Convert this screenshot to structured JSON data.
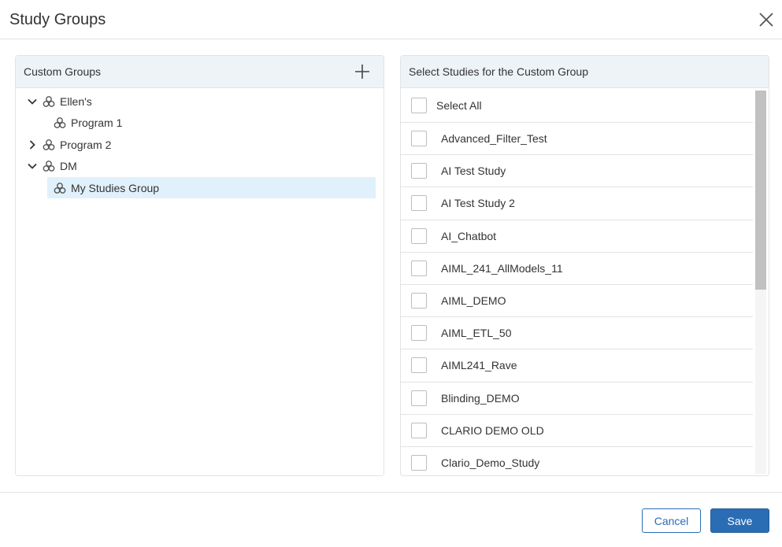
{
  "dialog": {
    "title": "Study Groups"
  },
  "left_panel": {
    "title": "Custom Groups",
    "tree": [
      {
        "label": "Ellen's",
        "expanded": true,
        "level": 0,
        "selected": false
      },
      {
        "label": "Program 1",
        "expanded": null,
        "level": 1,
        "selected": false
      },
      {
        "label": "Program 2",
        "expanded": false,
        "level": 0,
        "selected": false
      },
      {
        "label": "DM",
        "expanded": true,
        "level": 0,
        "selected": false
      },
      {
        "label": "My Studies Group",
        "expanded": null,
        "level": 1,
        "selected": true
      }
    ]
  },
  "right_panel": {
    "title": "Select Studies for the Custom Group",
    "select_all_label": "Select All",
    "studies": [
      {
        "name": "Advanced_Filter_Test",
        "checked": false
      },
      {
        "name": "AI Test Study",
        "checked": false
      },
      {
        "name": "AI Test Study 2",
        "checked": false
      },
      {
        "name": "AI_Chatbot",
        "checked": false
      },
      {
        "name": "AIML_241_AllModels_11",
        "checked": false
      },
      {
        "name": "AIML_DEMO",
        "checked": false
      },
      {
        "name": "AIML_ETL_50",
        "checked": false
      },
      {
        "name": "AIML241_Rave",
        "checked": false
      },
      {
        "name": "Blinding_DEMO",
        "checked": false
      },
      {
        "name": "CLARIO DEMO OLD",
        "checked": false
      },
      {
        "name": "Clario_Demo_Study",
        "checked": false
      }
    ]
  },
  "footer": {
    "cancel_label": "Cancel",
    "save_label": "Save"
  },
  "colors": {
    "accent": "#2a6db5",
    "header_bg": "#eef3f8",
    "selected_bg": "#e1f1fb",
    "border": "#e3e3e3"
  },
  "icons": {
    "close": "close-icon",
    "add": "plus-icon",
    "group": "group-icon",
    "expand": "chevron-right-icon",
    "collapse": "chevron-down-icon"
  }
}
